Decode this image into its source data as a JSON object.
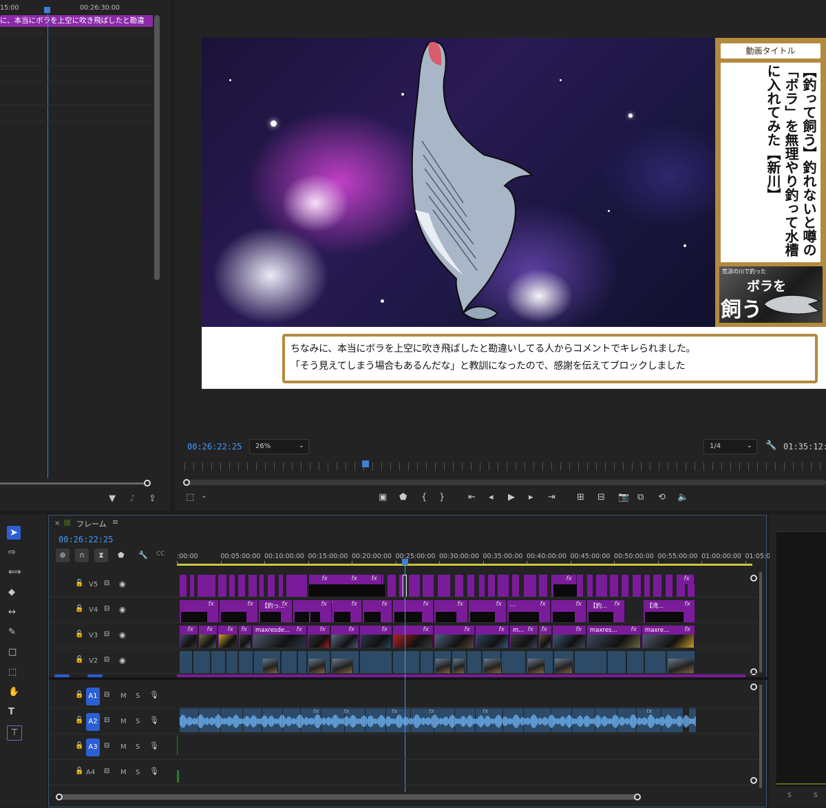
{
  "source_monitor": {
    "ruler_labels": [
      "15:00",
      "00:26:30:00"
    ],
    "clip_caption": "に、本当にボラを上空に吹き飛ばしたと勘違"
  },
  "program_monitor": {
    "video": {
      "title_badge": "動画タイトル",
      "title_vertical": "【釣って飼う】釣れないと噂の「ボラ」を無理やり釣って水槽に入れてみた【新川】",
      "thumb_text_small": "荒涼の川で釣った",
      "thumb_text_big1": "ボラを",
      "thumb_text_big2": "飼う",
      "subtitle_line1": "ちなみに、本当にボラを上空に吹き飛ばしたと勘違いしてる人からコメントでキレられました。",
      "subtitle_line2": "「そう見えてしまう場合もあるんだな」と教訓になったので、感謝を伝えてブロックしました"
    },
    "timecode_current": "00:26:22:25",
    "zoom_select": "26%",
    "resolution_select": "1/4",
    "timecode_duration": "01:35:12:2"
  },
  "timeline": {
    "sequence_name": "フレーム",
    "timecode": "00:26:22:25",
    "ruler_labels": [
      ":00:00",
      "00:05:00:00",
      "00:10:00:00",
      "00:15:00:00",
      "00:20:00:00",
      "00:25:00:00",
      "00:30:00:00",
      "00:35:00:00",
      "00:40:00:00",
      "00:45:00:00",
      "00:50:00:00",
      "00:55:00:00",
      "01:00:00:00",
      "01:05:00"
    ],
    "video_tracks": [
      "V5",
      "V4",
      "V3",
      "V2"
    ],
    "audio_tracks": [
      "A1",
      "A2",
      "A3",
      "A4"
    ],
    "mute_label": "M",
    "solo_label": "S",
    "clip_labels": {
      "v4_a": "【釣っ...",
      "v4_b": "...",
      "v4_c": "【釣...",
      "v4_d": "【湾...",
      "v3_a": "maxresde...",
      "v3_b": "m...",
      "v3_c": "maxres...",
      "v3_d": "maxre..."
    },
    "fx_label": "fx"
  },
  "meters": {
    "s_label": "S"
  },
  "colors": {
    "accent": "#3f9aff",
    "clip_purple": "#7a1c9a",
    "clip_blue": "#2d4b66",
    "gold": "#b48a3f"
  }
}
